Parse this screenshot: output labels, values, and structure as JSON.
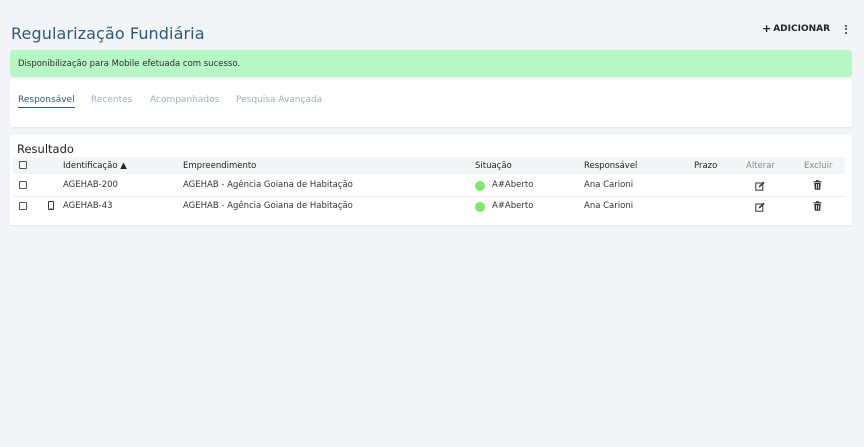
{
  "header": {
    "title": "Regularização Fundiária",
    "add_label": "ADICIONAR",
    "add_icon": "plus-icon",
    "more_icon": "more-vertical-icon"
  },
  "alert": {
    "message": "Disponibilização para Mobile efetuada com sucesso.",
    "color": "#b7f7c4"
  },
  "tabs": [
    {
      "label": "Responsável",
      "active": true
    },
    {
      "label": "Recentes",
      "active": false
    },
    {
      "label": "Acompanhados",
      "active": false
    },
    {
      "label": "Pesquisa Avançada",
      "active": false
    }
  ],
  "results": {
    "title": "Resultado",
    "columns": {
      "identificacao": "Identificação ▲",
      "empreendimento": "Empreendimento",
      "situacao": "Situação",
      "responsavel": "Responsável",
      "prazo": "Prazo",
      "alterar": "Alterar",
      "excluir": "Excluir"
    },
    "rows": [
      {
        "identificacao": "AGEHAB-200",
        "empreendimento": "AGEHAB - Agência Goiana de Habitação",
        "situacao": "A#Aberto",
        "responsavel": "Ana Carioni",
        "prazo": "",
        "mobile": false,
        "status_color": "#7ee86a"
      },
      {
        "identificacao": "AGEHAB-43",
        "empreendimento": "AGEHAB - Agência Goiana de Habitação",
        "situacao": "A#Aberto",
        "responsavel": "Ana Carioni",
        "prazo": "",
        "mobile": true,
        "status_color": "#7ee86a"
      }
    ]
  },
  "colors": {
    "accent": "#2a5a7b",
    "tab_inactive": "#9eb0be",
    "status_open": "#7ee86a"
  }
}
